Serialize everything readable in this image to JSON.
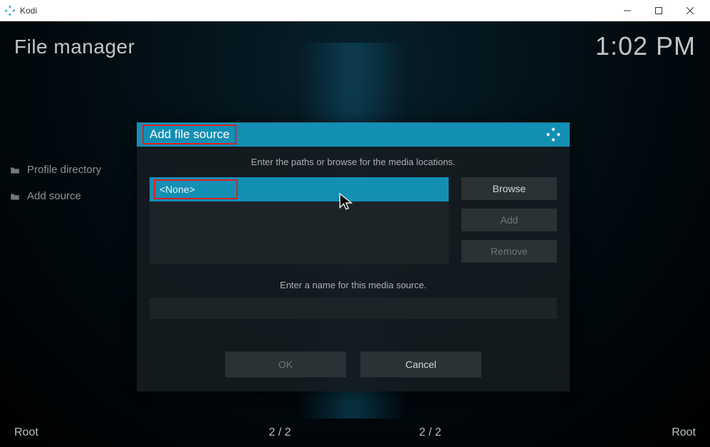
{
  "window": {
    "app_name": "Kodi"
  },
  "page": {
    "title": "File manager",
    "clock": "1:02 PM"
  },
  "sidebar": {
    "items": [
      {
        "label": "Profile directory"
      },
      {
        "label": "Add source"
      }
    ]
  },
  "statusbar": {
    "left": "Root",
    "count_a": "2 / 2",
    "count_b": "2 / 2",
    "right": "Root"
  },
  "dialog": {
    "title": "Add file source",
    "instruction_paths": "Enter the paths or browse for the media locations.",
    "path_value": "<None>",
    "buttons": {
      "browse": "Browse",
      "add": "Add",
      "remove": "Remove"
    },
    "instruction_name": "Enter a name for this media source.",
    "name_value": "",
    "footer": {
      "ok": "OK",
      "cancel": "Cancel"
    }
  }
}
